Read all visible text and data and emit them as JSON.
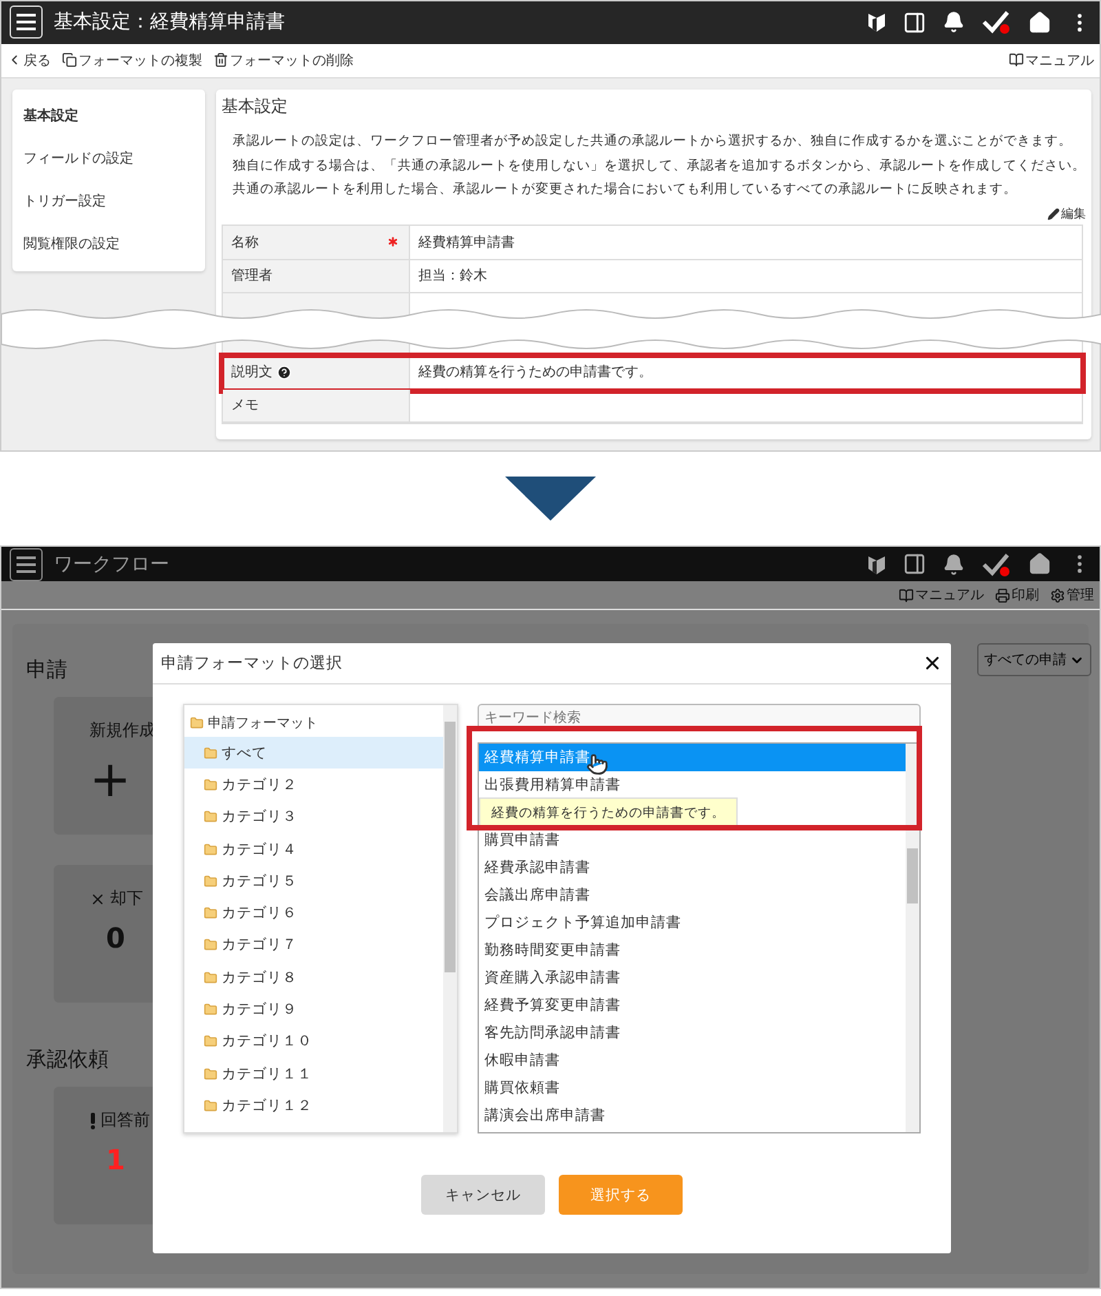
{
  "top_screen": {
    "header": {
      "title": "基本設定：経費精算申請書"
    },
    "toolbar": {
      "actions": [
        {
          "kind": "back",
          "label": "戻る"
        },
        {
          "kind": "copy",
          "label": "フォーマットの複製"
        },
        {
          "kind": "delete",
          "label": "フォーマットの削除"
        }
      ],
      "manual": "マニュアル"
    },
    "sidebar": {
      "items": [
        {
          "label": "基本設定",
          "selected": true
        },
        {
          "label": "フィールドの設定",
          "selected": false
        },
        {
          "label": "トリガー設定",
          "selected": false
        },
        {
          "label": "閲覧権限の設定",
          "selected": false
        }
      ]
    },
    "main": {
      "title": "基本設定",
      "description": [
        "承認ルートの設定は、ワークフロー管理者が予め設定した共通の承認ルートから選択するか、独自に作成するかを選ぶことができます。",
        "独自に作成する場合は、「共通の承認ルートを使用しない」を選択して、承認者を追加するボタンから、承認ルートを作成してください。",
        "共通の承認ルートを利用した場合、承認ルートが変更された場合においても利用しているすべての承認ルートに反映されます。"
      ],
      "edit_link": "編集",
      "fields": [
        {
          "kind": "field",
          "label": "名称",
          "value": "経費精算申請書",
          "required": true,
          "help": false,
          "highlighted": false
        },
        {
          "kind": "field",
          "label": "管理者",
          "value": "担当：鈴木",
          "required": false,
          "help": false,
          "highlighted": false
        },
        {
          "kind": "torn"
        },
        {
          "kind": "field",
          "label": "説明文",
          "value": "経費の精算を行うための申請書です。",
          "required": false,
          "help": true,
          "highlighted": true
        },
        {
          "kind": "field",
          "label": "メモ",
          "required": false,
          "help": false,
          "highlighted": false
        }
      ]
    }
  },
  "bottom_screen": {
    "header": {
      "title": "ワークフロー"
    },
    "toolbar": [
      {
        "kind": "manual",
        "label": "マニュアル"
      },
      {
        "kind": "print",
        "label": "印刷"
      },
      {
        "kind": "admin",
        "label": "管理"
      }
    ],
    "filter": {
      "value": "すべての申請"
    },
    "sections": [
      {
        "title": "申請",
        "cards": [
          {
            "kind": "create",
            "label": "新規作成",
            "value": "+"
          },
          {
            "kind": "rejected",
            "label": "却下",
            "value": "0"
          }
        ]
      },
      {
        "title": "承認依頼",
        "cards": [
          {
            "kind": "pending",
            "label": "回答前",
            "value": "1"
          }
        ]
      }
    ],
    "dialog": {
      "title": "申請フォーマットの選択",
      "tree": {
        "label": "申請フォーマット",
        "children": [
          {
            "label": "すべて",
            "selected": true
          },
          {
            "label": "カテゴリ２",
            "selected": false
          },
          {
            "label": "カテゴリ３",
            "selected": false
          },
          {
            "label": "カテゴリ４",
            "selected": false
          },
          {
            "label": "カテゴリ５",
            "selected": false
          },
          {
            "label": "カテゴリ６",
            "selected": false
          },
          {
            "label": "カテゴリ７",
            "selected": false
          },
          {
            "label": "カテゴリ８",
            "selected": false
          },
          {
            "label": "カテゴリ９",
            "selected": false
          },
          {
            "label": "カテゴリ１０",
            "selected": false
          },
          {
            "label": "カテゴリ１１",
            "selected": false
          },
          {
            "label": "カテゴリ１２",
            "selected": false
          }
        ]
      },
      "search": {
        "placeholder": "キーワード検索"
      },
      "formats": [
        {
          "label": "経費精算申請書",
          "selected": true
        },
        {
          "label": "出張費用精算申請書",
          "selected": false
        },
        {
          "label": "購買申請書",
          "selected": false
        },
        {
          "label": "経費承認申請書",
          "selected": false
        },
        {
          "label": "会議出席申請書",
          "selected": false
        },
        {
          "label": "プロジェクト予算追加申請書",
          "selected": false
        },
        {
          "label": "勤務時間変更申請書",
          "selected": false
        },
        {
          "label": "資産購入承認申請書",
          "selected": false
        },
        {
          "label": "経費予算変更申請書",
          "selected": false
        },
        {
          "label": "客先訪問承認申請書",
          "selected": false
        },
        {
          "label": "休暇申請書",
          "selected": false
        },
        {
          "label": "購買依頼書",
          "selected": false
        },
        {
          "label": "講演会出席申請書",
          "selected": false
        }
      ],
      "tooltip": "経費の精算を行うための申請書です。",
      "buttons": [
        {
          "kind": "cancel",
          "label": "キャンセル"
        },
        {
          "kind": "primary",
          "label": "選択する"
        }
      ]
    }
  }
}
